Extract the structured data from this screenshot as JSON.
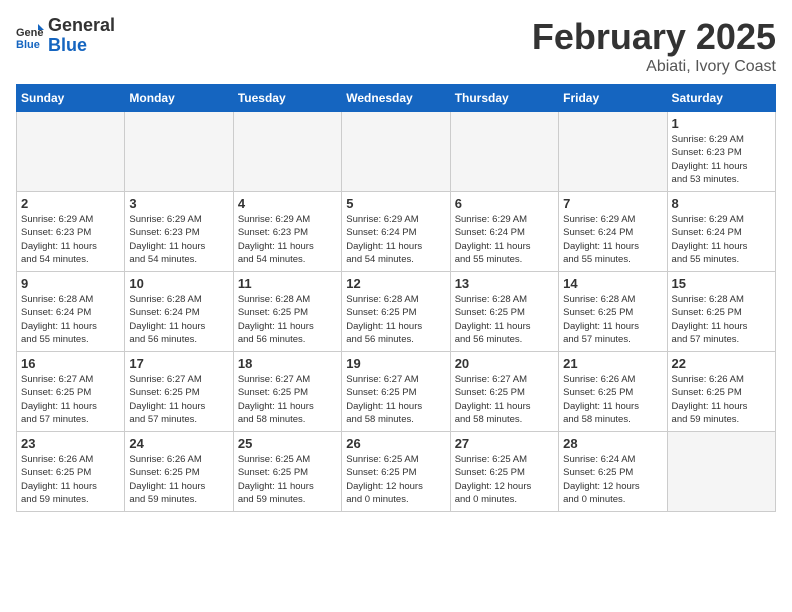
{
  "header": {
    "logo_general": "General",
    "logo_blue": "Blue",
    "month_title": "February 2025",
    "location": "Abiati, Ivory Coast"
  },
  "weekdays": [
    "Sunday",
    "Monday",
    "Tuesday",
    "Wednesday",
    "Thursday",
    "Friday",
    "Saturday"
  ],
  "weeks": [
    [
      {
        "day": "",
        "info": ""
      },
      {
        "day": "",
        "info": ""
      },
      {
        "day": "",
        "info": ""
      },
      {
        "day": "",
        "info": ""
      },
      {
        "day": "",
        "info": ""
      },
      {
        "day": "",
        "info": ""
      },
      {
        "day": "1",
        "info": "Sunrise: 6:29 AM\nSunset: 6:23 PM\nDaylight: 11 hours\nand 53 minutes."
      }
    ],
    [
      {
        "day": "2",
        "info": "Sunrise: 6:29 AM\nSunset: 6:23 PM\nDaylight: 11 hours\nand 54 minutes."
      },
      {
        "day": "3",
        "info": "Sunrise: 6:29 AM\nSunset: 6:23 PM\nDaylight: 11 hours\nand 54 minutes."
      },
      {
        "day": "4",
        "info": "Sunrise: 6:29 AM\nSunset: 6:23 PM\nDaylight: 11 hours\nand 54 minutes."
      },
      {
        "day": "5",
        "info": "Sunrise: 6:29 AM\nSunset: 6:24 PM\nDaylight: 11 hours\nand 54 minutes."
      },
      {
        "day": "6",
        "info": "Sunrise: 6:29 AM\nSunset: 6:24 PM\nDaylight: 11 hours\nand 55 minutes."
      },
      {
        "day": "7",
        "info": "Sunrise: 6:29 AM\nSunset: 6:24 PM\nDaylight: 11 hours\nand 55 minutes."
      },
      {
        "day": "8",
        "info": "Sunrise: 6:29 AM\nSunset: 6:24 PM\nDaylight: 11 hours\nand 55 minutes."
      }
    ],
    [
      {
        "day": "9",
        "info": "Sunrise: 6:28 AM\nSunset: 6:24 PM\nDaylight: 11 hours\nand 55 minutes."
      },
      {
        "day": "10",
        "info": "Sunrise: 6:28 AM\nSunset: 6:24 PM\nDaylight: 11 hours\nand 56 minutes."
      },
      {
        "day": "11",
        "info": "Sunrise: 6:28 AM\nSunset: 6:25 PM\nDaylight: 11 hours\nand 56 minutes."
      },
      {
        "day": "12",
        "info": "Sunrise: 6:28 AM\nSunset: 6:25 PM\nDaylight: 11 hours\nand 56 minutes."
      },
      {
        "day": "13",
        "info": "Sunrise: 6:28 AM\nSunset: 6:25 PM\nDaylight: 11 hours\nand 56 minutes."
      },
      {
        "day": "14",
        "info": "Sunrise: 6:28 AM\nSunset: 6:25 PM\nDaylight: 11 hours\nand 57 minutes."
      },
      {
        "day": "15",
        "info": "Sunrise: 6:28 AM\nSunset: 6:25 PM\nDaylight: 11 hours\nand 57 minutes."
      }
    ],
    [
      {
        "day": "16",
        "info": "Sunrise: 6:27 AM\nSunset: 6:25 PM\nDaylight: 11 hours\nand 57 minutes."
      },
      {
        "day": "17",
        "info": "Sunrise: 6:27 AM\nSunset: 6:25 PM\nDaylight: 11 hours\nand 57 minutes."
      },
      {
        "day": "18",
        "info": "Sunrise: 6:27 AM\nSunset: 6:25 PM\nDaylight: 11 hours\nand 58 minutes."
      },
      {
        "day": "19",
        "info": "Sunrise: 6:27 AM\nSunset: 6:25 PM\nDaylight: 11 hours\nand 58 minutes."
      },
      {
        "day": "20",
        "info": "Sunrise: 6:27 AM\nSunset: 6:25 PM\nDaylight: 11 hours\nand 58 minutes."
      },
      {
        "day": "21",
        "info": "Sunrise: 6:26 AM\nSunset: 6:25 PM\nDaylight: 11 hours\nand 58 minutes."
      },
      {
        "day": "22",
        "info": "Sunrise: 6:26 AM\nSunset: 6:25 PM\nDaylight: 11 hours\nand 59 minutes."
      }
    ],
    [
      {
        "day": "23",
        "info": "Sunrise: 6:26 AM\nSunset: 6:25 PM\nDaylight: 11 hours\nand 59 minutes."
      },
      {
        "day": "24",
        "info": "Sunrise: 6:26 AM\nSunset: 6:25 PM\nDaylight: 11 hours\nand 59 minutes."
      },
      {
        "day": "25",
        "info": "Sunrise: 6:25 AM\nSunset: 6:25 PM\nDaylight: 11 hours\nand 59 minutes."
      },
      {
        "day": "26",
        "info": "Sunrise: 6:25 AM\nSunset: 6:25 PM\nDaylight: 12 hours\nand 0 minutes."
      },
      {
        "day": "27",
        "info": "Sunrise: 6:25 AM\nSunset: 6:25 PM\nDaylight: 12 hours\nand 0 minutes."
      },
      {
        "day": "28",
        "info": "Sunrise: 6:24 AM\nSunset: 6:25 PM\nDaylight: 12 hours\nand 0 minutes."
      },
      {
        "day": "",
        "info": ""
      }
    ]
  ]
}
